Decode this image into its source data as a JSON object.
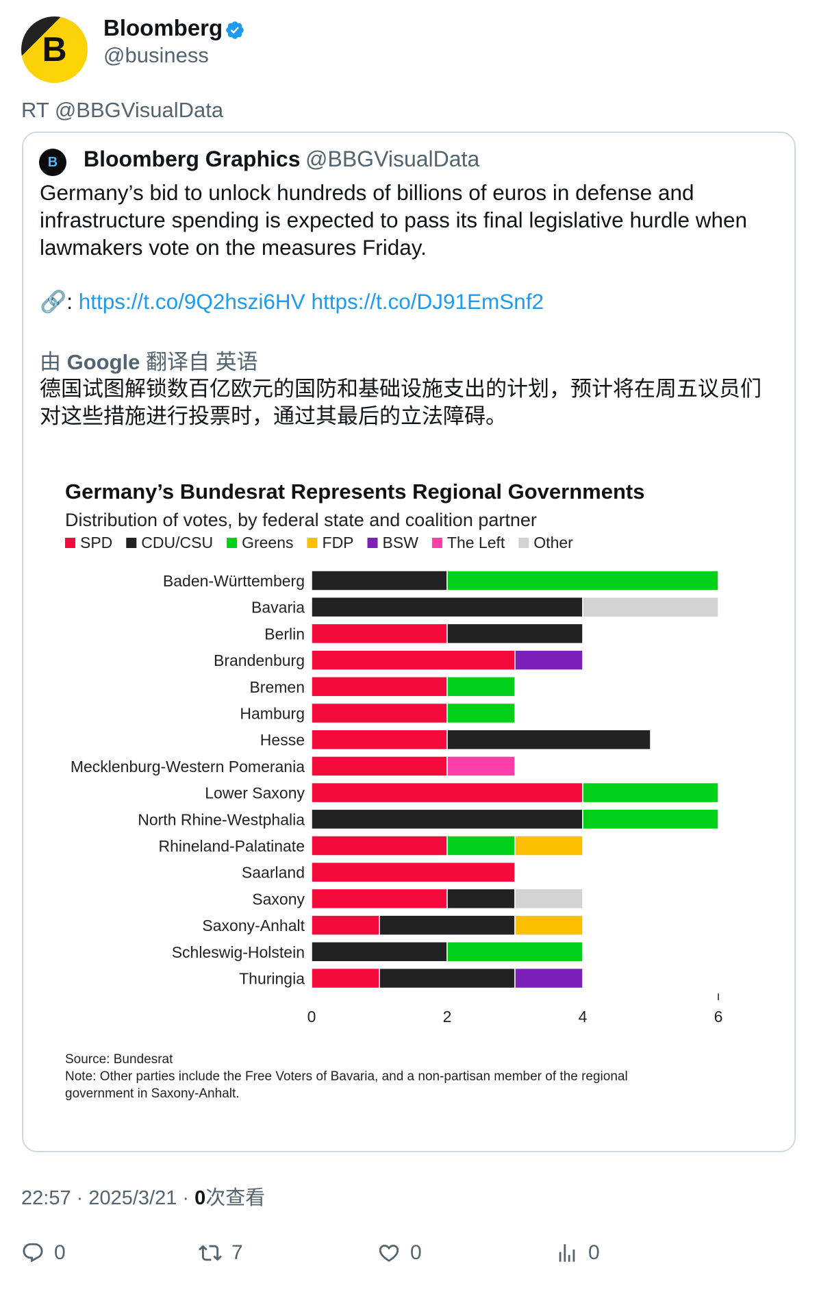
{
  "header": {
    "avatar_letter": "B",
    "display_name": "Bloomberg",
    "handle": "@business",
    "retweet_line": "RT @BBGVisualData"
  },
  "quote": {
    "avatar_letter": "B",
    "display_name": "Bloomberg Graphics",
    "handle": "@BBGVisualData",
    "body": "Germany’s bid to unlock hundreds of billions of euros in defense and infrastructure spending is expected to pass its final legislative hurdle when lawmakers vote on the measures Friday.",
    "link_icon": "🔗",
    "link_sep": ":",
    "link1": "https://t.co/9Q2hszi6HV",
    "link2": "https://t.co/DJ91EmSnf2",
    "translate_prefix": "由",
    "translate_brand": "Google",
    "translate_suffix": "翻译自 英语",
    "translation": "德国试图解锁数百亿欧元的国防和基础设施支出的计划，预计将在周五议员们对这些措施进行投票时，通过其最后的立法障碍。"
  },
  "chart_data": {
    "type": "bar",
    "orientation": "horizontal",
    "stacked": true,
    "title": "Germany’s Bundesrat Represents Regional Governments",
    "subtitle": "Distribution of votes, by federal state and coalition partner",
    "categories": [
      "Baden-Württemberg",
      "Bavaria",
      "Berlin",
      "Brandenburg",
      "Bremen",
      "Hamburg",
      "Hesse",
      "Mecklenburg-Western Pomerania",
      "Lower Saxony",
      "North Rhine-Westphalia",
      "Rhineland-Palatinate",
      "Saarland",
      "Saxony",
      "Saxony-Anhalt",
      "Schleswig-Holstein",
      "Thuringia"
    ],
    "series": [
      {
        "name": "SPD",
        "color": "#f50a3c",
        "values": [
          0,
          0,
          2,
          3,
          2,
          2,
          2,
          2,
          4,
          0,
          2,
          3,
          2,
          1,
          0,
          1
        ]
      },
      {
        "name": "CDU/CSU",
        "color": "#222222",
        "values": [
          2,
          4,
          2,
          0,
          0,
          0,
          3,
          0,
          0,
          4,
          0,
          0,
          1,
          2,
          2,
          2
        ]
      },
      {
        "name": "Greens",
        "color": "#00d118",
        "values": [
          4,
          0,
          0,
          0,
          1,
          1,
          0,
          0,
          2,
          2,
          1,
          0,
          0,
          0,
          2,
          0
        ]
      },
      {
        "name": "FDP",
        "color": "#fcc000",
        "values": [
          0,
          0,
          0,
          0,
          0,
          0,
          0,
          0,
          0,
          0,
          1,
          0,
          0,
          1,
          0,
          0
        ]
      },
      {
        "name": "BSW",
        "color": "#7e1fb8",
        "values": [
          0,
          0,
          0,
          1,
          0,
          0,
          0,
          0,
          0,
          0,
          0,
          0,
          0,
          0,
          0,
          1
        ]
      },
      {
        "name": "The Left",
        "color": "#ff3ea8",
        "values": [
          0,
          0,
          0,
          0,
          0,
          0,
          0,
          1,
          0,
          0,
          0,
          0,
          0,
          0,
          0,
          0
        ]
      },
      {
        "name": "Other",
        "color": "#d2d2d2",
        "values": [
          0,
          2,
          0,
          0,
          0,
          0,
          0,
          0,
          0,
          0,
          0,
          0,
          1,
          0,
          0,
          0
        ]
      }
    ],
    "xticks": [
      "0",
      "2",
      "4",
      "6"
    ],
    "xlim": [
      0,
      6
    ],
    "legend_position": "top-left",
    "grid": false,
    "source": "Source: Bundesrat",
    "note_line1": "Note: Other parties include the Free Voters of Bavaria, and a non-partisan member of the regional",
    "note_line2": "government in Saxony-Anhalt."
  },
  "footer": {
    "time": "22:57 · 2025/3/21 · ",
    "views_count": "0",
    "views_label": "次查看",
    "replies": "0",
    "retweets": "7",
    "likes": "0",
    "analytics": "0"
  },
  "icons": {
    "verified": "verified-badge-icon",
    "reply": "reply-icon",
    "retweet": "retweet-icon",
    "like": "heart-icon",
    "analytics": "analytics-icon"
  }
}
